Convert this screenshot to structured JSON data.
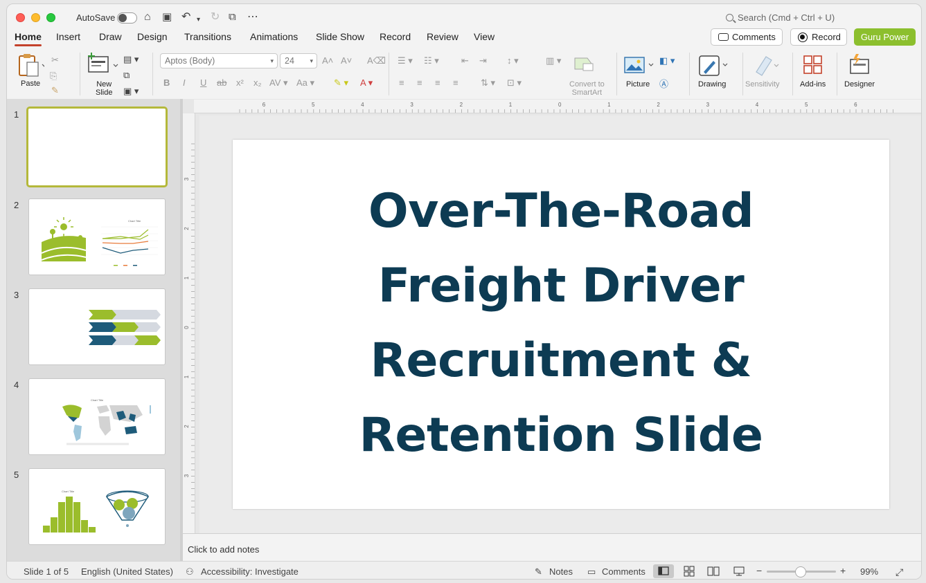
{
  "window": {
    "autosave_label": "AutoSave",
    "search_placeholder": "Search (Cmd + Ctrl + U)"
  },
  "tabs": [
    "Home",
    "Insert",
    "Draw",
    "Design",
    "Transitions",
    "Animations",
    "Slide Show",
    "Record",
    "Review",
    "View"
  ],
  "active_tab": "Home",
  "header_buttons": {
    "comments": "Comments",
    "record": "Record",
    "guru": "Guru Power"
  },
  "ribbon": {
    "paste": "Paste",
    "new_slide_line1": "New",
    "new_slide_line2": "Slide",
    "font_name": "Aptos (Body)",
    "font_size": "24",
    "convert_line1": "Convert to",
    "convert_line2": "SmartArt",
    "picture": "Picture",
    "drawing": "Drawing",
    "sensitivity": "Sensitivity",
    "addins": "Add-ins",
    "designer": "Designer"
  },
  "thumbnails": [
    {
      "number": "1"
    },
    {
      "number": "2",
      "mini_chart_title": "Chart Title"
    },
    {
      "number": "3"
    },
    {
      "number": "4",
      "mini_chart_title": "Chart Title"
    },
    {
      "number": "5",
      "mini_chart_title": "Chart Title"
    }
  ],
  "ruler": {
    "h_labels": [
      "6",
      "5",
      "4",
      "3",
      "2",
      "1",
      "0",
      "1",
      "2",
      "3",
      "4",
      "5",
      "6"
    ],
    "v_labels": [
      "3",
      "2",
      "1",
      "0",
      "1",
      "2",
      "3"
    ]
  },
  "slide": {
    "title_lines": [
      "Over-The-Road",
      "Freight Driver",
      "Recruitment &",
      "Retention Slide"
    ]
  },
  "notes_placeholder": "Click to add notes",
  "status": {
    "slide_counter": "Slide 1 of 5",
    "language": "English (United States)",
    "accessibility": "Accessibility: Investigate",
    "notes": "Notes",
    "comments": "Comments",
    "zoom": "99%"
  },
  "colors": {
    "accent_tab": "#c4422b",
    "guru": "#8cbf2e",
    "title_text": "#0d3b53",
    "thumb_green": "#9bbd2c",
    "thumb_navy": "#1e5b7a"
  }
}
